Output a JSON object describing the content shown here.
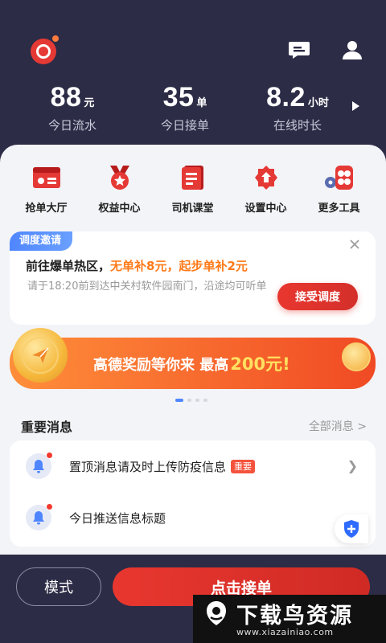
{
  "header": {
    "stats": [
      {
        "value": "88",
        "unit": "元",
        "label": "今日流水"
      },
      {
        "value": "35",
        "unit": "单",
        "label": "今日接单"
      },
      {
        "value": "8.2",
        "unit": "小时",
        "label": "在线时长"
      }
    ]
  },
  "tools": [
    {
      "label": "抢单大厅",
      "icon": "order-hall-icon"
    },
    {
      "label": "权益中心",
      "icon": "medal-icon"
    },
    {
      "label": "司机课堂",
      "icon": "book-icon"
    },
    {
      "label": "设置中心",
      "icon": "settings-icon"
    },
    {
      "label": "更多工具",
      "icon": "more-tools-icon"
    }
  ],
  "dispatch": {
    "badge": "调度邀请",
    "title_prefix": "前往爆单热区，",
    "title_highlight": "无单补8元，起步单补2元",
    "desc": "请于18:20前到达中关村软件园南门，沿途均可听单",
    "accept_label": "接受调度"
  },
  "banner": {
    "text": "高德奖励等你来 最高",
    "amount": "200元!"
  },
  "messages": {
    "title": "重要消息",
    "all_label": "全部消息 >",
    "items": [
      {
        "text": "置顶消息请及时上传防疫信息",
        "tag": "重要"
      },
      {
        "text": "今日推送信息标题",
        "tag": ""
      }
    ]
  },
  "bottom": {
    "mode_label": "模式",
    "take_label": "点击接单"
  },
  "watermark": {
    "title": "下载鸟资源",
    "url": "www.xiazainiao.com"
  },
  "colors": {
    "header_bg": "#2c2c46",
    "accent_red": "#e8372f",
    "accent_blue": "#4f86ff",
    "highlight_orange": "#ff7a1a"
  }
}
